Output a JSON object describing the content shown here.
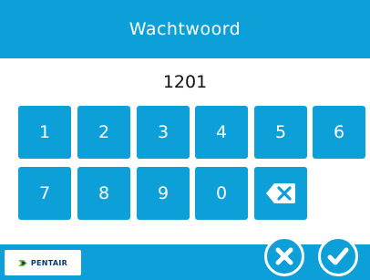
{
  "header": {
    "title": "Wachtwoord"
  },
  "entry": {
    "value": "1201"
  },
  "keypad": {
    "keys": [
      "1",
      "2",
      "3",
      "4",
      "5",
      "6",
      "7",
      "8",
      "9",
      "0"
    ],
    "backspace_icon": "backspace-x-icon"
  },
  "footer": {
    "logo_text": "PENTAIR",
    "cancel_icon": "close-x-icon",
    "confirm_icon": "checkmark-icon"
  },
  "colors": {
    "accent": "#0d9fd8",
    "background": "#ffffff",
    "text": "#111111"
  }
}
